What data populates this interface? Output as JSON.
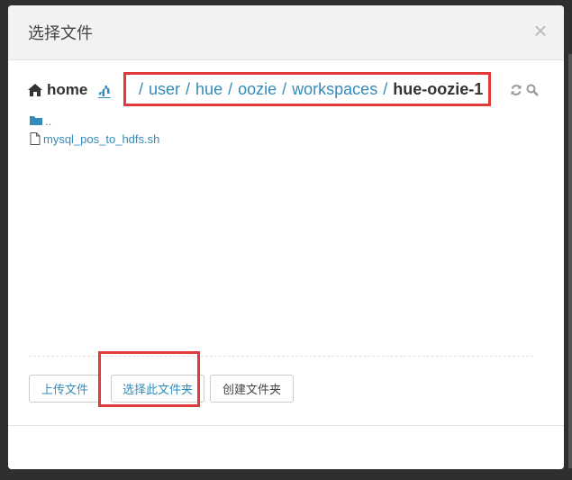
{
  "dialog": {
    "title": "选择文件",
    "close_symbol": "×"
  },
  "breadcrumb": {
    "home_label": "home",
    "edit_symbol": "ⶃ",
    "separator": "/",
    "segments": [
      "user",
      "hue",
      "oozie",
      "workspaces"
    ],
    "current": "hue-oozie-1"
  },
  "files": [
    {
      "name": "..",
      "type": "folder"
    },
    {
      "name": "mysql_pos_to_hdfs.sh",
      "type": "file"
    }
  ],
  "actions": {
    "upload_label": "上传文件",
    "select_folder_label": "选择此文件夹",
    "create_folder_label": "创建文件夹"
  },
  "colors": {
    "link": "#338bb8",
    "highlight": "#e03a3a",
    "header_bg": "#f2f2f2"
  }
}
